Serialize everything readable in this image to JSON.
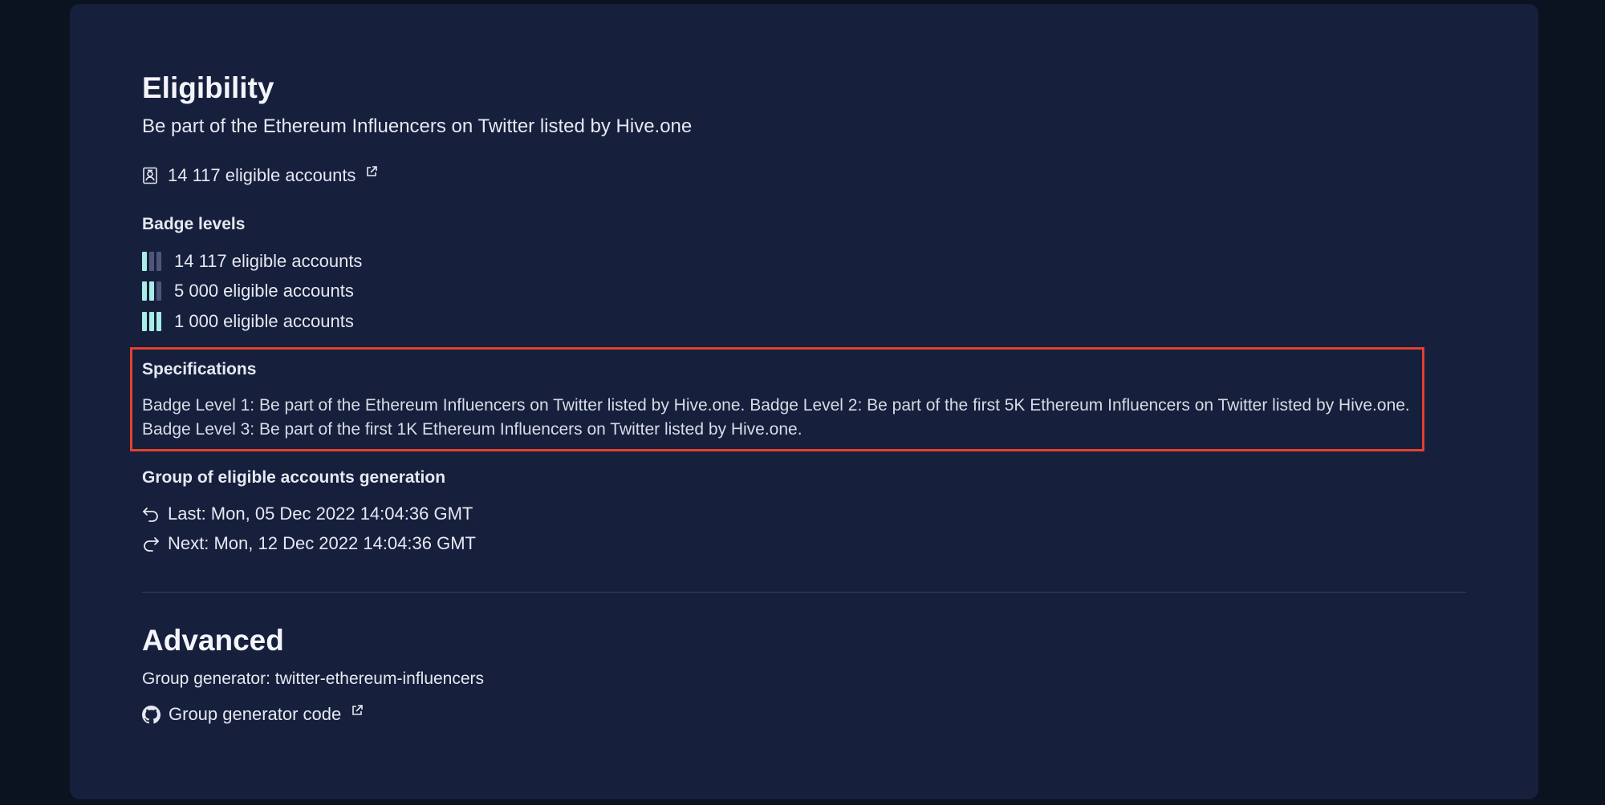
{
  "eligibility": {
    "title": "Eligibility",
    "description": "Be part of the Ethereum Influencers on Twitter listed by Hive.one",
    "eligible_accounts_link": "14 117 eligible accounts",
    "badge_levels": {
      "title": "Badge levels",
      "levels": [
        {
          "label": "14 117 eligible accounts",
          "filled_bars": 1,
          "total_bars": 3
        },
        {
          "label": "5 000 eligible accounts",
          "filled_bars": 2,
          "total_bars": 3
        },
        {
          "label": "1 000 eligible accounts",
          "filled_bars": 3,
          "total_bars": 3
        }
      ]
    },
    "specifications": {
      "title": "Specifications",
      "text": "Badge Level 1: Be part of the Ethereum Influencers on Twitter listed by Hive.one. Badge Level 2: Be part of the first 5K Ethereum Influencers on Twitter listed by Hive.one. Badge Level 3: Be part of the first 1K Ethereum Influencers on Twitter listed by Hive.one."
    },
    "generation": {
      "title": "Group of eligible accounts generation",
      "last": "Last: Mon, 05 Dec 2022 14:04:36 GMT",
      "next": "Next: Mon, 12 Dec 2022 14:04:36 GMT"
    }
  },
  "advanced": {
    "title": "Advanced",
    "generator": "Group generator: twitter-ethereum-influencers",
    "code_link": "Group generator code"
  },
  "colors": {
    "background": "#0b1220",
    "panel": "#161f3b",
    "bar_on": "#a8ece5",
    "bar_off": "#4e5779",
    "highlight_border": "#e3412f"
  },
  "icons": [
    "id-badge-icon",
    "external-link-icon",
    "undo-icon",
    "redo-icon",
    "github-icon"
  ]
}
